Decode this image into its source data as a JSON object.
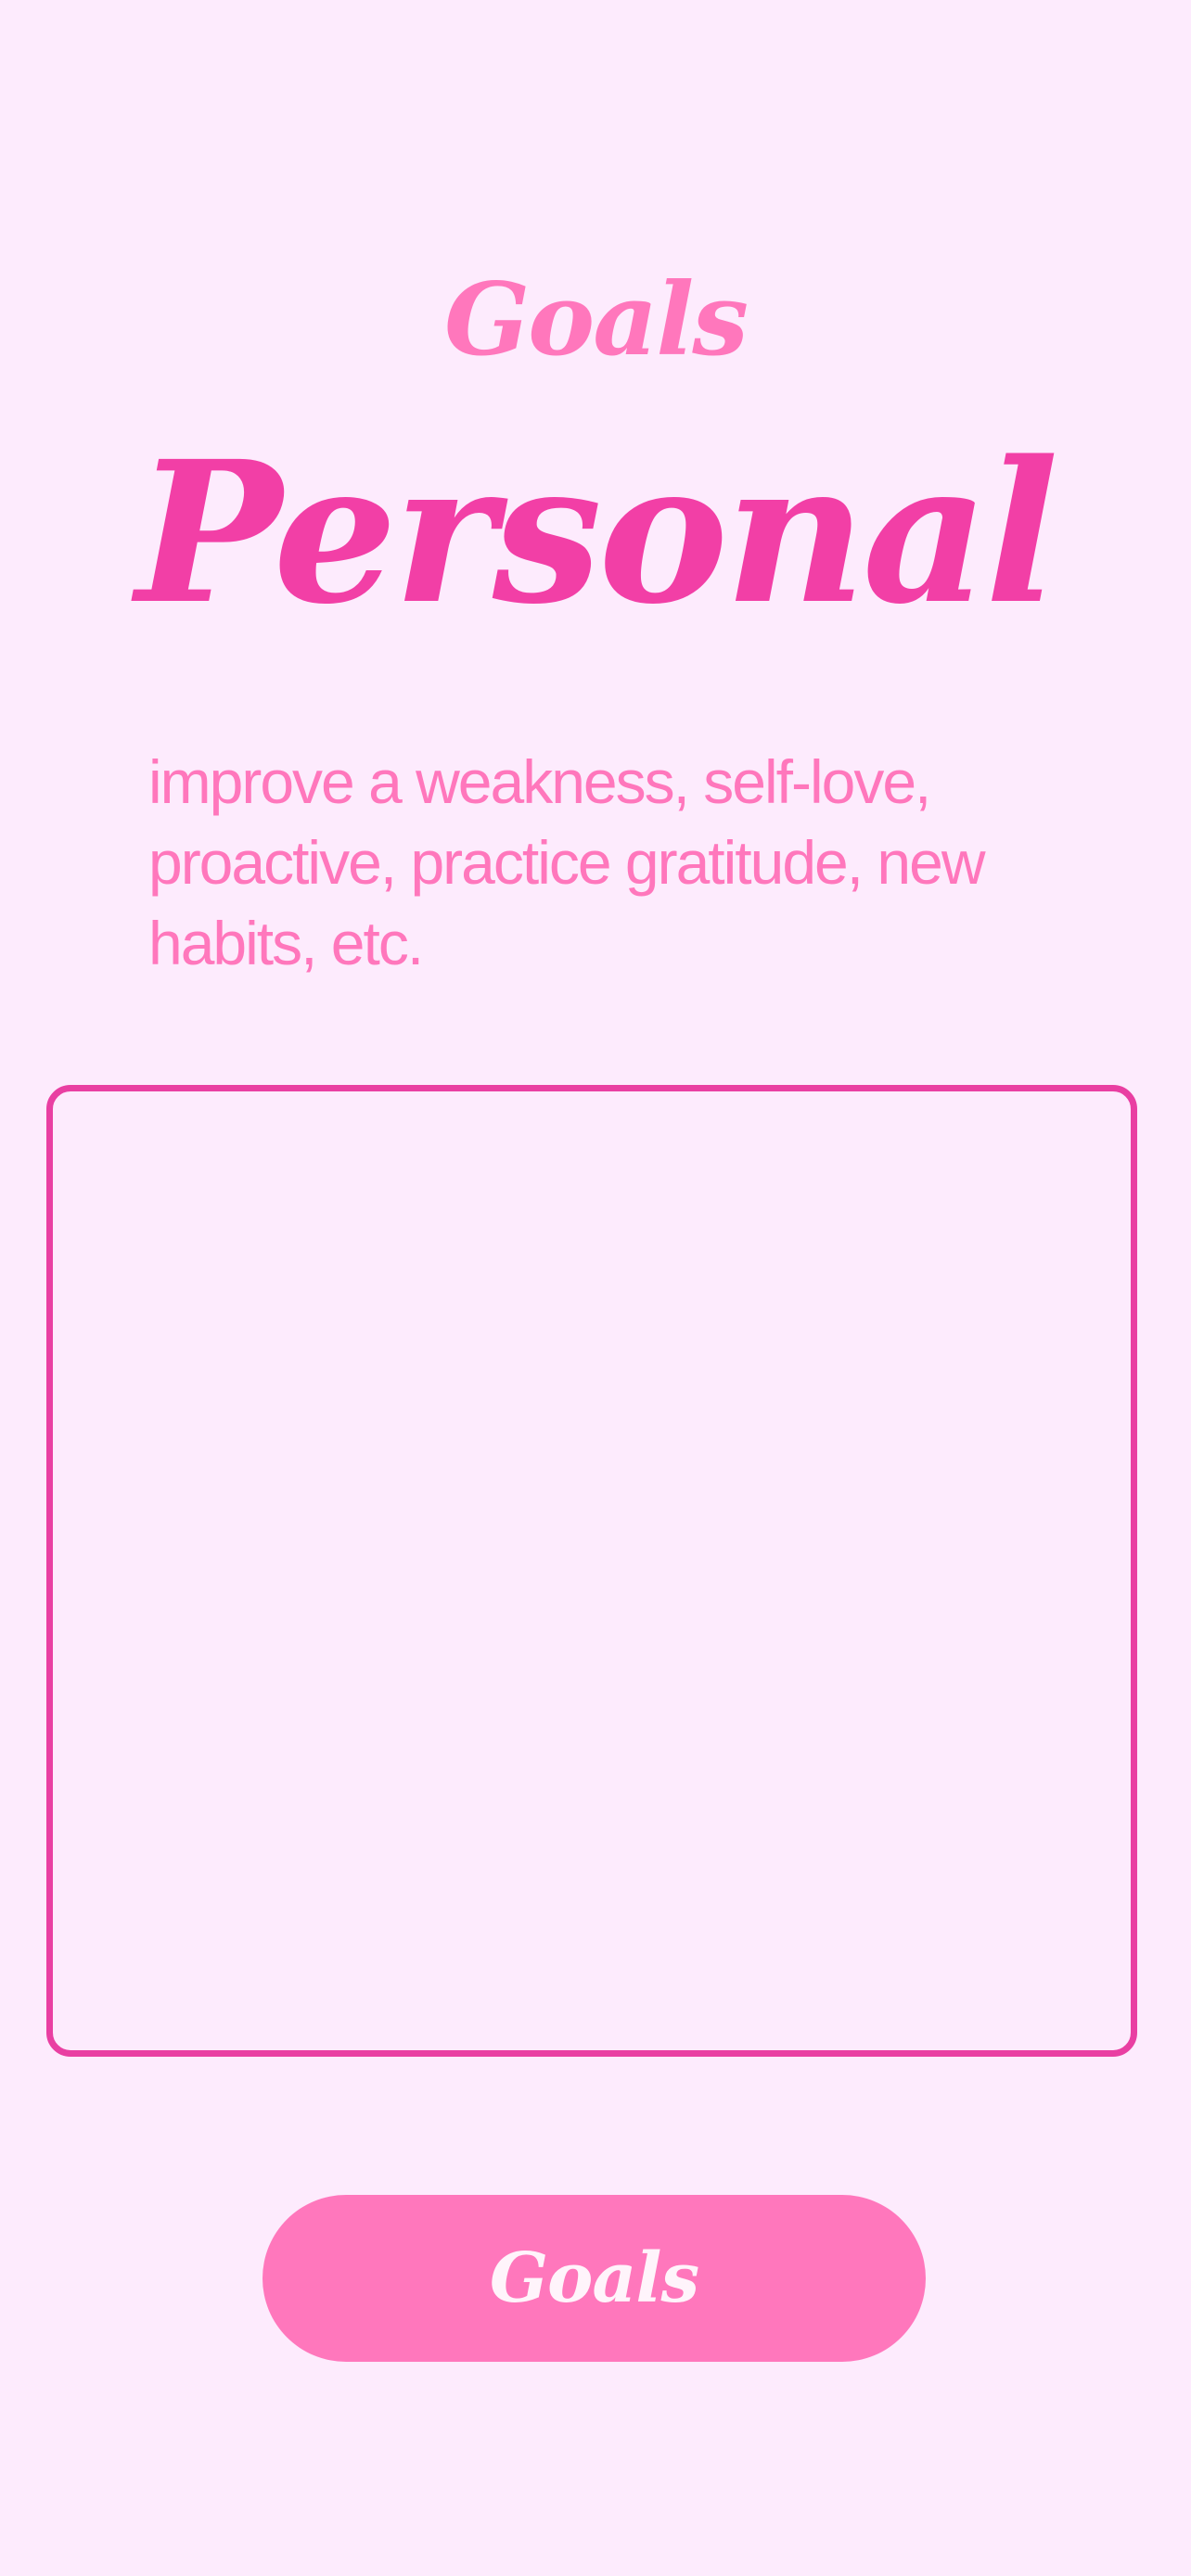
{
  "header": {
    "kicker": "Goals",
    "title": "Personal"
  },
  "prompt": {
    "description": "improve a weakness, self-love, proactive, practice gratitude, new habits, etc."
  },
  "notes": {
    "value": ""
  },
  "footer": {
    "button_label": "Goals"
  },
  "colors": {
    "background": "#FDEBFD",
    "accent_dark": "#F23FA6",
    "accent_light": "#FF77BC",
    "border": "#E93FA2",
    "button_text": "#FFF4FB"
  }
}
